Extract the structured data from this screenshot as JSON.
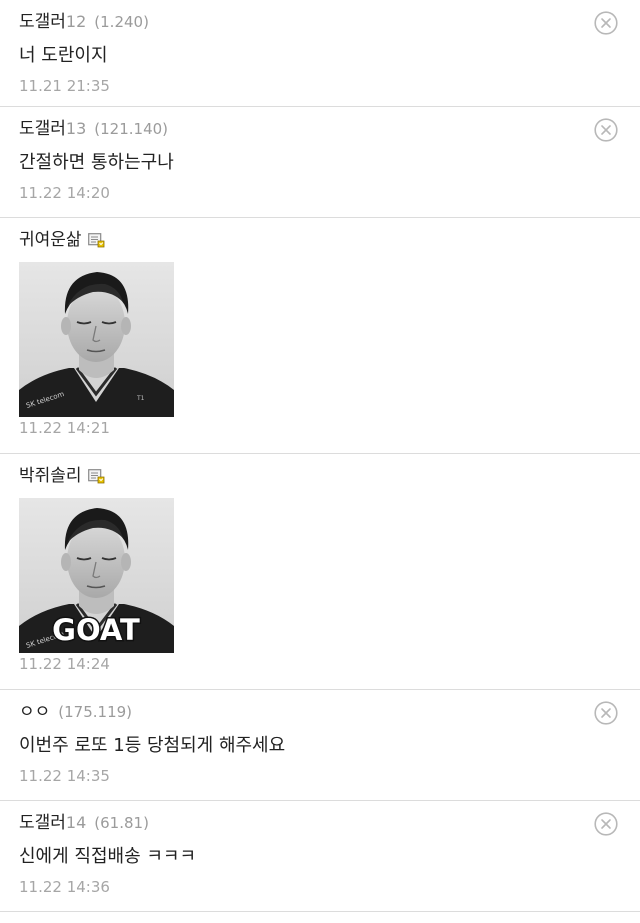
{
  "comments": [
    {
      "nick": "도갤러",
      "nick_num": "12",
      "ip": "(1.240)",
      "text": "너 도란이지",
      "date": "11.21 21:35",
      "deletable": true
    },
    {
      "nick": "도갤러",
      "nick_num": "13",
      "ip": "(121.140)",
      "text": "간절하면 통하는구나",
      "date": "11.22 14:20",
      "deletable": true
    },
    {
      "nick": "귀여운삶",
      "date": "11.22 14:21",
      "dccon_icon": "portrait-photo-eyes-closed",
      "gallog_icon": "gallog-icon"
    },
    {
      "nick": "박쥐솔리",
      "date": "11.22 14:24",
      "dccon_icon": "portrait-photo-goat",
      "dccon_caption": "GOAT",
      "gallog_icon": "gallog-icon"
    },
    {
      "nick": "ㅇㅇ",
      "ip": "(175.119)",
      "text": "이번주 로또 1등 당첨되게 해주세요",
      "date": "11.22 14:35",
      "deletable": true
    },
    {
      "nick": "도갤러",
      "nick_num": "14",
      "ip": "(61.81)",
      "text": "신에게 직접배송 ㅋㅋㅋ",
      "date": "11.22 14:36",
      "deletable": true
    }
  ],
  "colors": {
    "divider": "#dcdcdc",
    "meta_gray": "#9b9b9b",
    "date_gray": "#a6a6a6",
    "text": "#222222"
  },
  "icons": {
    "delete": "close-circle-icon",
    "gallog": "gallog-icon"
  }
}
